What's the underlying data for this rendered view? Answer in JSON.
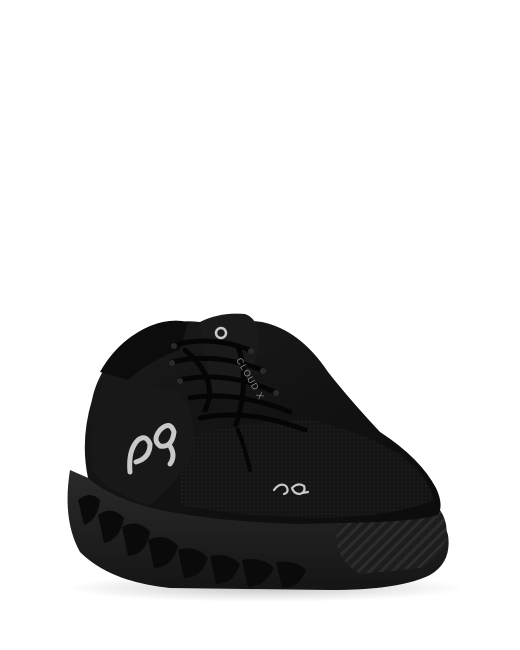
{
  "image": {
    "subject": "sneaker-product-photo",
    "background_color": "#ffffff",
    "shoe_color": "#121212",
    "logo_color": "#c9c9c9"
  },
  "shoe": {
    "tongue_label": "CLOUD X",
    "side_logo_icon": "on-logo-icon",
    "toe_logo_icon": "on-logo-small-icon"
  }
}
